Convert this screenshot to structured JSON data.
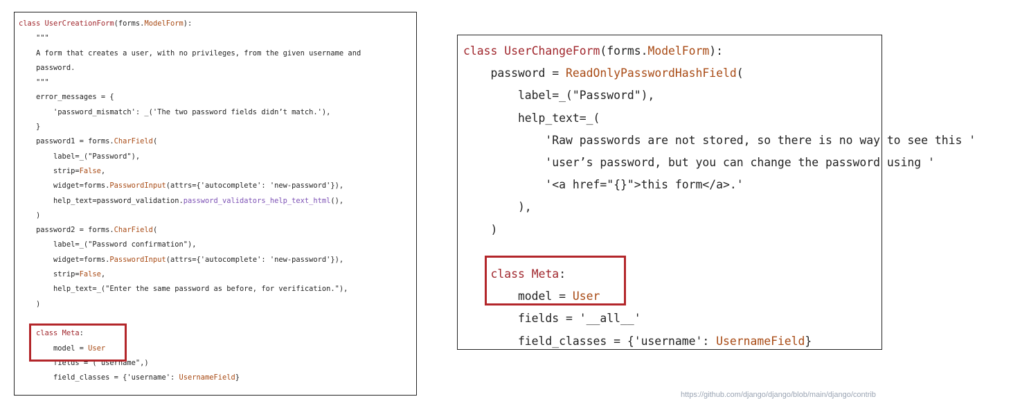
{
  "left_panel": {
    "lines": [
      "class UserCreationForm(forms.ModelForm):",
      "    \"\"\"",
      "    A form that creates a user, with no privileges, from the given username and",
      "    password.",
      "    \"\"\"",
      "    error_messages = {",
      "        'password_mismatch': _('The two password fields didn’t match.'),",
      "    }",
      "    password1 = forms.CharField(",
      "        label=_(\"Password\"),",
      "        strip=False,",
      "        widget=forms.PasswordInput(attrs={'autocomplete': 'new-password'}),",
      "        help_text=password_validation.password_validators_help_text_html(),",
      "    )",
      "    password2 = forms.CharField(",
      "        label=_(\"Password confirmation\"),",
      "        widget=forms.PasswordInput(attrs={'autocomplete': 'new-password'}),",
      "        strip=False,",
      "        help_text=_(\"Enter the same password as before, for verification.\"),",
      "    )",
      "",
      "    class Meta:",
      "        model = User",
      "        fields = (\"username\",)",
      "        field_classes = {'username': UsernameField}"
    ]
  },
  "right_panel": {
    "lines": [
      "class UserChangeForm(forms.ModelForm):",
      "    password = ReadOnlyPasswordHashField(",
      "        label=_(\"Password\"),",
      "        help_text=_(",
      "            'Raw passwords are not stored, so there is no way to see this '",
      "            'user’s password, but you can change the password using '",
      "            '<a href=\"{}\">this form</a>.'",
      "        ),",
      "    )",
      "",
      "    class Meta:",
      "        model = User",
      "        fields = '__all__'",
      "        field_classes = {'username': UsernameField}"
    ]
  },
  "footer": {
    "url_fragment": "https://github.com/django/django/blob/main/django/contrib"
  },
  "colors": {
    "keyword": "#a0262c",
    "highlight_box": "#b3262a",
    "text": "#222222"
  }
}
